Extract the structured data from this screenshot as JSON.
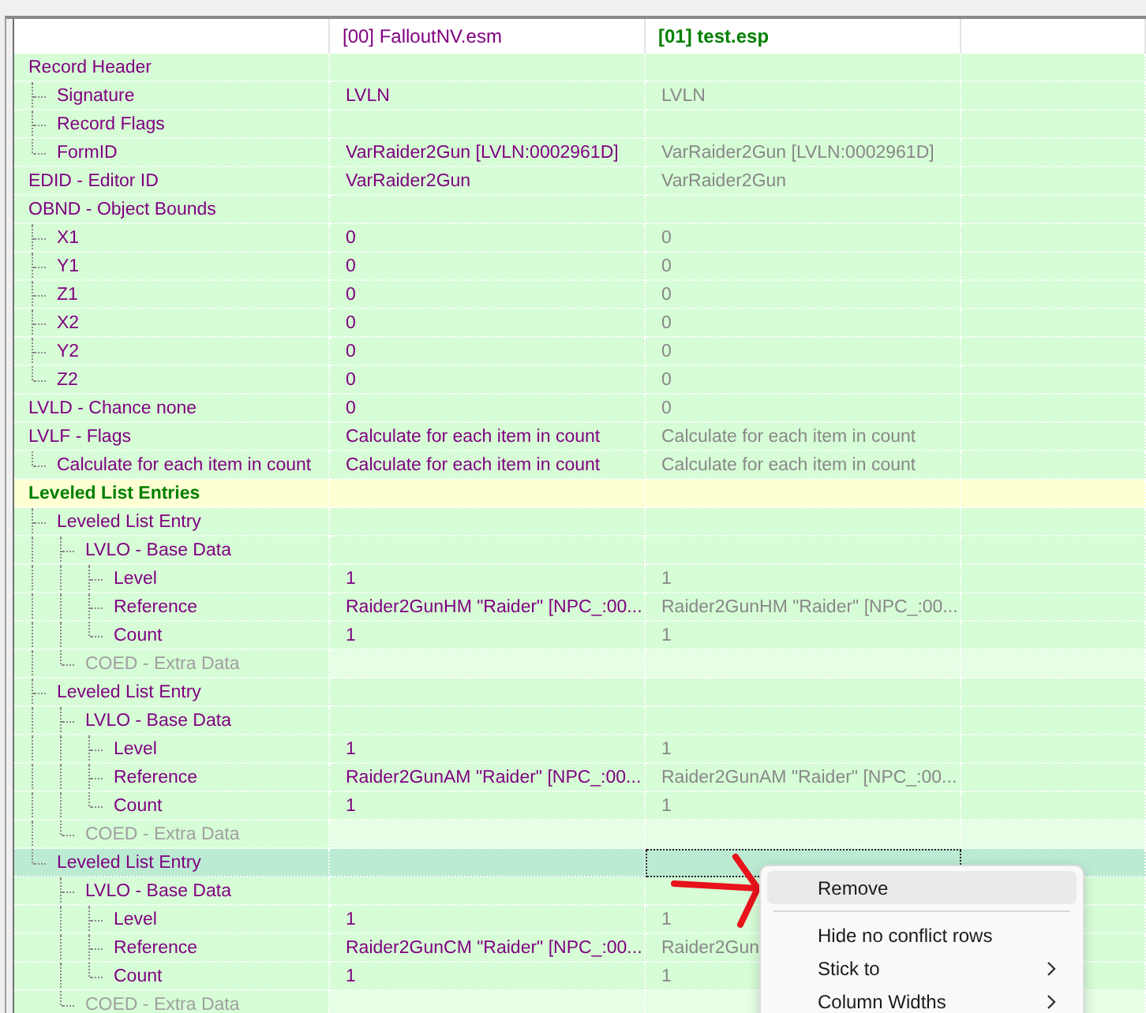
{
  "columns": [
    {
      "label": "[00] FalloutNV.esm",
      "kind": "master"
    },
    {
      "label": "[01] test.esp",
      "kind": "override"
    }
  ],
  "rows": [
    {
      "label": "Record Header",
      "kind": "normal",
      "selected": false,
      "children": [
        {
          "label": "Signature",
          "kind": "normal",
          "selected": false,
          "values": [
            "LVLN",
            "LVLN"
          ]
        },
        {
          "label": "Record Flags",
          "kind": "normal",
          "selected": false
        },
        {
          "label": "FormID",
          "kind": "normal",
          "selected": false,
          "values": [
            "VarRaider2Gun [LVLN:0002961D]",
            "VarRaider2Gun [LVLN:0002961D]"
          ]
        }
      ]
    },
    {
      "label": "EDID - Editor ID",
      "kind": "normal",
      "selected": false,
      "values": [
        "VarRaider2Gun",
        "VarRaider2Gun"
      ]
    },
    {
      "label": "OBND - Object Bounds",
      "kind": "normal",
      "selected": false,
      "children": [
        {
          "label": "X1",
          "kind": "normal",
          "selected": false,
          "values": [
            "0",
            "0"
          ]
        },
        {
          "label": "Y1",
          "kind": "normal",
          "selected": false,
          "values": [
            "0",
            "0"
          ]
        },
        {
          "label": "Z1",
          "kind": "normal",
          "selected": false,
          "values": [
            "0",
            "0"
          ]
        },
        {
          "label": "X2",
          "kind": "normal",
          "selected": false,
          "values": [
            "0",
            "0"
          ]
        },
        {
          "label": "Y2",
          "kind": "normal",
          "selected": false,
          "values": [
            "0",
            "0"
          ]
        },
        {
          "label": "Z2",
          "kind": "normal",
          "selected": false,
          "values": [
            "0",
            "0"
          ]
        }
      ]
    },
    {
      "label": "LVLD - Chance none",
      "kind": "normal",
      "selected": false,
      "values": [
        "0",
        "0"
      ]
    },
    {
      "label": "LVLF - Flags",
      "kind": "normal",
      "selected": false,
      "values": [
        "Calculate for each item in count",
        "Calculate for each item in count"
      ],
      "children": [
        {
          "label": "Calculate for each item in count",
          "kind": "normal",
          "selected": false,
          "values": [
            "Calculate for each item in count",
            "Calculate for each item in count"
          ]
        }
      ]
    },
    {
      "label": "Leveled List Entries",
      "kind": "section",
      "selected": false,
      "children": [
        {
          "label": "Leveled List Entry",
          "kind": "normal",
          "selected": false,
          "children": [
            {
              "label": "LVLO - Base Data",
              "kind": "normal",
              "selected": false,
              "children": [
                {
                  "label": "Level",
                  "kind": "normal",
                  "selected": false,
                  "values": [
                    "1",
                    "1"
                  ]
                },
                {
                  "label": "Reference",
                  "kind": "normal",
                  "selected": false,
                  "values": [
                    "Raider2GunHM \"Raider\" [NPC_:00...",
                    "Raider2GunHM \"Raider\" [NPC_:00..."
                  ]
                },
                {
                  "label": "Count",
                  "kind": "normal",
                  "selected": false,
                  "values": [
                    "1",
                    "1"
                  ]
                }
              ]
            },
            {
              "label": "COED - Extra Data",
              "kind": "empty",
              "selected": false
            }
          ]
        },
        {
          "label": "Leveled List Entry",
          "kind": "normal",
          "selected": false,
          "children": [
            {
              "label": "LVLO - Base Data",
              "kind": "normal",
              "selected": false,
              "children": [
                {
                  "label": "Level",
                  "kind": "normal",
                  "selected": false,
                  "values": [
                    "1",
                    "1"
                  ]
                },
                {
                  "label": "Reference",
                  "kind": "normal",
                  "selected": false,
                  "values": [
                    "Raider2GunAM \"Raider\" [NPC_:00...",
                    "Raider2GunAM \"Raider\" [NPC_:00..."
                  ]
                },
                {
                  "label": "Count",
                  "kind": "normal",
                  "selected": false,
                  "values": [
                    "1",
                    "1"
                  ]
                }
              ]
            },
            {
              "label": "COED - Extra Data",
              "kind": "empty",
              "selected": false
            }
          ]
        },
        {
          "label": "Leveled List Entry",
          "kind": "normal",
          "selected": true,
          "children": [
            {
              "label": "LVLO - Base Data",
              "kind": "normal",
              "selected": false,
              "children": [
                {
                  "label": "Level",
                  "kind": "normal",
                  "selected": false,
                  "values": [
                    "1",
                    "1"
                  ]
                },
                {
                  "label": "Reference",
                  "kind": "normal",
                  "selected": false,
                  "values": [
                    "Raider2GunCM \"Raider\" [NPC_:00...",
                    "Raider2Gun"
                  ]
                },
                {
                  "label": "Count",
                  "kind": "normal",
                  "selected": false,
                  "values": [
                    "1",
                    "1"
                  ]
                }
              ]
            },
            {
              "label": "COED - Extra Data",
              "kind": "empty",
              "selected": false
            }
          ]
        }
      ]
    }
  ],
  "context_menu": [
    {
      "label": "Remove",
      "hovered": true,
      "submenu": false
    },
    {
      "kind": "separator"
    },
    {
      "label": "Hide no conflict rows",
      "hovered": false,
      "submenu": false
    },
    {
      "label": "Stick to",
      "hovered": false,
      "submenu": true
    },
    {
      "label": "Column Widths",
      "hovered": false,
      "submenu": true
    }
  ]
}
